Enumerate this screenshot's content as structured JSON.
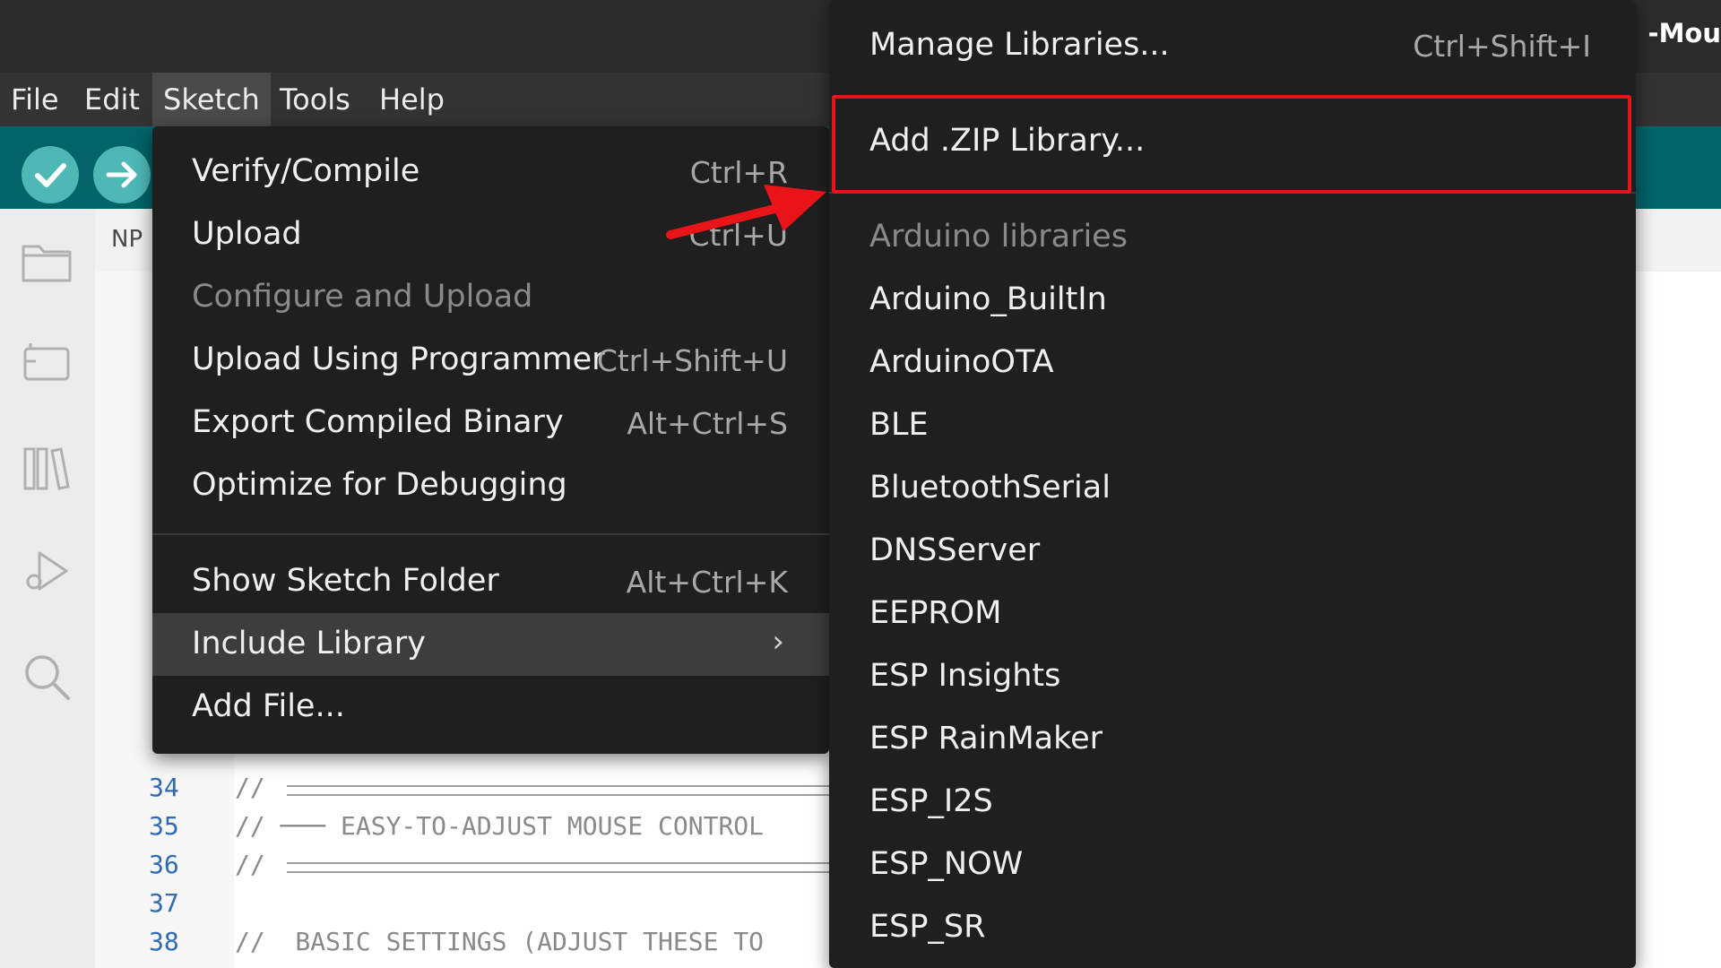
{
  "window": {
    "title_fragment": "-Mou"
  },
  "menubar": {
    "items": [
      {
        "label": "File"
      },
      {
        "label": "Edit"
      },
      {
        "label": "Sketch"
      },
      {
        "label": "Tools"
      },
      {
        "label": "Help"
      }
    ]
  },
  "editor": {
    "tab_label": "NP",
    "lines": [
      {
        "num": "34",
        "text": "//"
      },
      {
        "num": "35",
        "text": "// ─── EASY-TO-ADJUST MOUSE CONTROL"
      },
      {
        "num": "36",
        "text": "//"
      },
      {
        "num": "37",
        "text": ""
      },
      {
        "num": "38",
        "text": "//  BASIC SETTINGS (ADJUST THESE TO"
      }
    ]
  },
  "sketch_menu": {
    "items": [
      {
        "label": "Verify/Compile",
        "shortcut": "Ctrl+R"
      },
      {
        "label": "Upload",
        "shortcut": "Ctrl+U"
      },
      {
        "label": "Configure and Upload",
        "shortcut": ""
      },
      {
        "label": "Upload Using Programmer",
        "shortcut": "Ctrl+Shift+U"
      },
      {
        "label": "Export Compiled Binary",
        "shortcut": "Alt+Ctrl+S"
      },
      {
        "label": "Optimize for Debugging",
        "shortcut": ""
      },
      {
        "label": "Show Sketch Folder",
        "shortcut": "Alt+Ctrl+K"
      },
      {
        "label": "Include Library",
        "shortcut": ""
      },
      {
        "label": "Add File...",
        "shortcut": ""
      }
    ]
  },
  "library_menu": {
    "manage": {
      "label": "Manage Libraries...",
      "shortcut": "Ctrl+Shift+I"
    },
    "add_zip": {
      "label": "Add .ZIP Library..."
    },
    "section_header": "Arduino libraries",
    "libraries": [
      "Arduino_BuiltIn",
      "ArduinoOTA",
      "BLE",
      "BluetoothSerial",
      "DNSServer",
      "EEPROM",
      "ESP Insights",
      "ESP RainMaker",
      "ESP_I2S",
      "ESP_NOW",
      "ESP_SR"
    ]
  },
  "colors": {
    "toolbar": "#006468",
    "menu_bg": "#1f1f1f",
    "highlight_box": "#e8141a",
    "line_numbers": "#2f6bb4"
  }
}
